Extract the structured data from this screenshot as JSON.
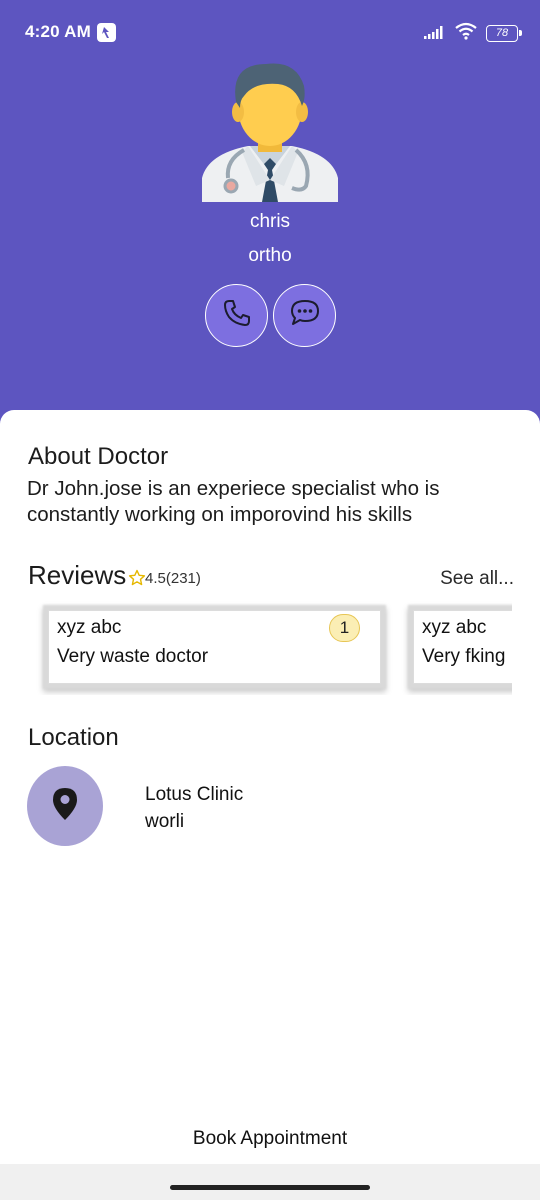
{
  "status_bar": {
    "time": "4:20 AM",
    "battery_level": "78",
    "icons": [
      "app-notification-icon",
      "signal-icon",
      "wifi-icon",
      "battery-icon"
    ]
  },
  "doctor": {
    "name": "chris",
    "specialty": "ortho",
    "avatar_icon": "doctor-avatar-icon"
  },
  "actions": {
    "call_icon": "phone-icon",
    "chat_icon": "chat-bubble-icon"
  },
  "about": {
    "title": "About Doctor",
    "text": " Dr John.jose is an experiece specialist who is constantly working on imporovind his skills"
  },
  "reviews": {
    "title": "Reviews",
    "rating": "4.5(231)",
    "see_all": "See all...",
    "items": [
      {
        "author": "xyz abc",
        "text": "Very waste doctor",
        "badge": "1"
      },
      {
        "author": "xyz abc",
        "text": "Very fking"
      }
    ]
  },
  "location": {
    "title": "Location",
    "clinic_name": "Lotus Clinic",
    "area": "worli",
    "icon": "map-pin-icon"
  },
  "book_button": {
    "label": "Book Appointment"
  },
  "colors": {
    "primary": "#5d55c0",
    "action_button": "#7d6fe0",
    "location_circle": "#a9a3d5",
    "star": "#e6b800",
    "badge_bg": "#fbeeb4"
  }
}
